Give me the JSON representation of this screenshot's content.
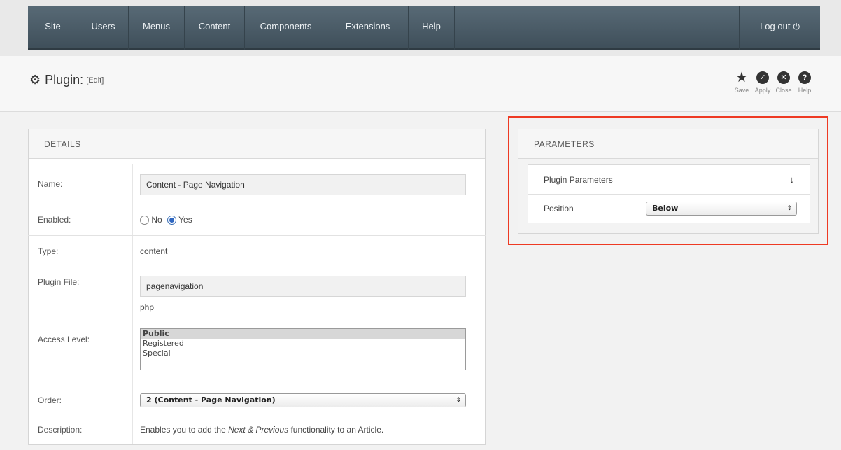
{
  "nav": {
    "items": [
      "Site",
      "Users",
      "Menus",
      "Content",
      "Components",
      "Extensions",
      "Help"
    ],
    "logout": "Log out",
    "logout_icon": "power-icon"
  },
  "header": {
    "title": "Plugin:",
    "subtitle": "[Edit]",
    "icon": "gears-icon"
  },
  "toolbar": {
    "save": "Save",
    "apply": "Apply",
    "close": "Close",
    "help": "Help"
  },
  "details": {
    "heading": "DETAILS",
    "name_label": "Name:",
    "name_value": "Content - Page Navigation",
    "enabled_label": "Enabled:",
    "enabled_no": "No",
    "enabled_yes": "Yes",
    "enabled_selected": "Yes",
    "type_label": "Type:",
    "type_value": "content",
    "file_label": "Plugin File:",
    "file_value": "pagenavigation",
    "file_ext": "php",
    "access_label": "Access Level:",
    "access_options": [
      "Public",
      "Registered",
      "Special"
    ],
    "access_selected": "Public",
    "order_label": "Order:",
    "order_value": "2 (Content - Page Navigation)",
    "description_label": "Description:",
    "description_pre": "Enables you to add the ",
    "description_em": "Next & Previous",
    "description_post": " functionality to an Article."
  },
  "parameters": {
    "heading": "PARAMETERS",
    "group_title": "Plugin Parameters",
    "position_label": "Position",
    "position_value": "Below"
  },
  "colors": {
    "nav_bg": "#4b5b66",
    "highlight": "#ee3a23",
    "radio_checked": "#2f67c1"
  }
}
